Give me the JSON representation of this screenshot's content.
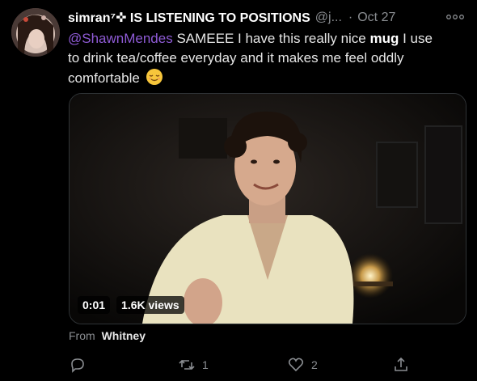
{
  "tweet": {
    "display_name": "simran⁷✜ IS LISTENING TO POSITIONS",
    "handle": "@j...",
    "separator": "·",
    "date": "Oct 27",
    "text": {
      "mention": "@ShawnMendes",
      "part1": " SAMEEE I have this really nice ",
      "bold": "mug",
      "part2": " I use to drink tea/coffee everyday and it makes me feel oddly comfortable "
    },
    "emoji_icon": "relieved-face-icon",
    "video": {
      "time": "0:01",
      "views": "1.6K views"
    },
    "source": {
      "prefix": "From",
      "name": "Whitney"
    },
    "actions": {
      "reply_count": "",
      "retweet_count": "1",
      "like_count": "2"
    }
  },
  "colors": {
    "background": "#000000",
    "mention": "#8f5bd6",
    "secondary_text": "#8a8d91"
  }
}
